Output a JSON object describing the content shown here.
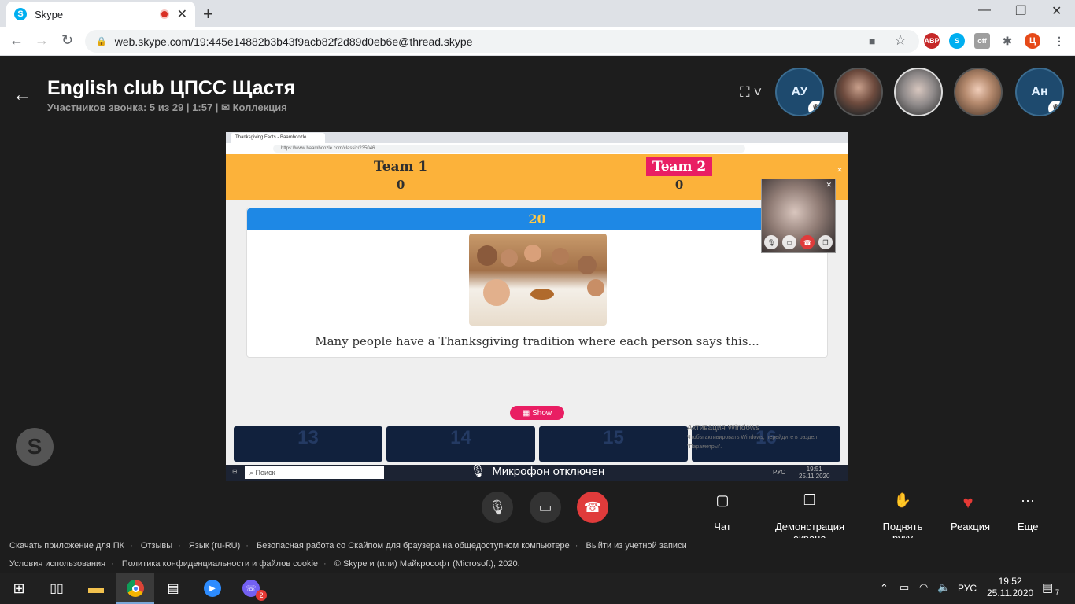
{
  "browser": {
    "tab_title": "Skype",
    "tab_favicon": "S",
    "url": "web.skype.com/19:445e14882b3b43f9acb82f2d89d0eb6e@thread.skype"
  },
  "call": {
    "title": "English club ЦПСС Щастя",
    "subtitle": "Участников звонка: 5 из 29 | 1:57 |",
    "collection": "Коллекция",
    "participants": [
      {
        "initials": "АУ",
        "muted": true
      },
      {
        "initials": "",
        "muted": false
      },
      {
        "initials": "",
        "muted": false
      },
      {
        "initials": "",
        "muted": false
      },
      {
        "initials": "Ан",
        "muted": true
      }
    ]
  },
  "shared": {
    "tab_title": "Thanksgiving Facts - Baamboozle",
    "url": "https://www.baamboozle.com/classic/235046",
    "team1": {
      "name": "Team 1",
      "score": "0"
    },
    "team2": {
      "name": "Team 2",
      "score": "0"
    },
    "points": "20",
    "question": "Many people have a Thanksgiving tradition where each person says this...",
    "show_label": "Show",
    "tiles": [
      "13",
      "14",
      "15",
      "16"
    ],
    "activate_title": "Активация Windows",
    "activate_text": "Чтобы активировать Windows, перейдите в раздел \"Параметры\".",
    "taskbar_search": "Поиск",
    "taskbar_lang": "РУС",
    "taskbar_time": "19:51",
    "taskbar_date": "25.11.2020"
  },
  "toast": "Микрофон отключен",
  "controls": {
    "chat": "Чат",
    "share": "Демонстрация экрана",
    "raise": "Поднять руку",
    "react": "Реакция",
    "more": "Еще"
  },
  "footer": {
    "row1": [
      "Скачать приложение для ПК",
      "Отзывы",
      "Язык (ru-RU)",
      "Безопасная работа со Скайпом для браузера на общедоступном компьютере",
      "Выйти из учетной записи"
    ],
    "row2": [
      "Условия использования",
      "Политика конфиденциальности и файлов cookie",
      "© Skype и (или) Майкрософт (Microsoft), 2020."
    ]
  },
  "taskbar": {
    "lang": "РУС",
    "time": "19:52",
    "date": "25.11.2020",
    "notif_count": "7",
    "viber_badge": "2"
  },
  "colors": {
    "hangup": "#e03b3b",
    "reaction": "#e53935",
    "baamboozle_header": "#fcb23a",
    "team2": "#e91e63",
    "card_bar": "#1e88e5"
  }
}
